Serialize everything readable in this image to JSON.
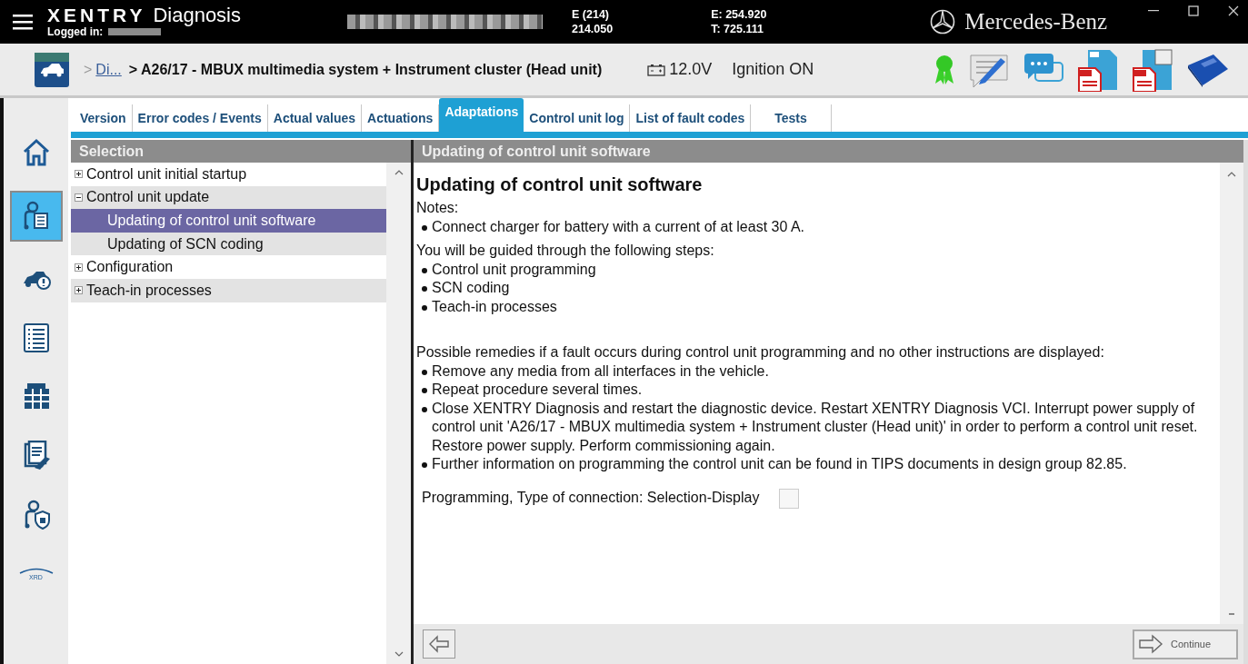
{
  "titlebar": {
    "brand": "XENTRY",
    "product": "Diagnosis",
    "logged_in_label": "Logged in:",
    "vehicle_model": "E (214)",
    "vehicle_code": "214.050",
    "engine": "E: 254.920",
    "transmission": "T: 725.111",
    "maker": "Mercedes-Benz"
  },
  "toolbar": {
    "breadcrumb_prefix": ">",
    "breadcrumb_link": "Di...",
    "breadcrumb_current": "> A26/17 - MBUX multimedia system + Instrument cluster (Head unit)",
    "voltage": "12.0V",
    "ignition": "Ignition ON"
  },
  "sidebar": {
    "items": [
      {
        "kind": "home",
        "selected": false
      },
      {
        "kind": "control-unit",
        "selected": true
      },
      {
        "kind": "car-alert",
        "selected": false
      },
      {
        "kind": "list",
        "selected": false
      },
      {
        "kind": "grid",
        "selected": false
      },
      {
        "kind": "document-wrench",
        "selected": false
      },
      {
        "kind": "lock-unit",
        "selected": false
      },
      {
        "kind": "xrd",
        "label": "XRD",
        "selected": false
      }
    ]
  },
  "tabs": [
    {
      "label": "Version",
      "selected": false
    },
    {
      "label": "Error codes / Events",
      "selected": false
    },
    {
      "label": "Actual values",
      "selected": false
    },
    {
      "label": "Actuations",
      "selected": false
    },
    {
      "label": "Adaptations",
      "selected": true
    },
    {
      "label": "Control unit log",
      "selected": false
    },
    {
      "label": "List of fault codes",
      "selected": false
    },
    {
      "label": "Tests",
      "selected": false
    }
  ],
  "tree": {
    "header": "Selection",
    "items": [
      {
        "label": "Control unit initial startup",
        "expanded": false,
        "selected": false
      },
      {
        "label": "Control unit update",
        "expanded": true,
        "selected": false,
        "children": [
          {
            "label": "Updating of control unit software",
            "selected": true
          },
          {
            "label": "Updating of SCN coding",
            "selected": false
          }
        ]
      },
      {
        "label": "Configuration",
        "expanded": false,
        "selected": false
      },
      {
        "label": "Teach-in processes",
        "expanded": false,
        "selected": false
      }
    ]
  },
  "content": {
    "header": "Updating of control unit software",
    "title": "Updating of control unit software",
    "notes_label": "Notes:",
    "notes": [
      "Connect charger for battery with a current of at least 30 A."
    ],
    "steps_intro": "You will be guided through the following steps:",
    "steps": [
      "Control unit programming",
      "SCN coding",
      "Teach-in processes"
    ],
    "remedies_intro": "Possible remedies if a fault occurs during control unit programming and no other instructions are displayed:",
    "remedies": [
      "Remove any media from all interfaces in the vehicle.",
      "Repeat procedure several times.",
      "Close XENTRY Diagnosis and restart the diagnostic device. Restart XENTRY Diagnosis VCI. Interrupt power supply of control unit 'A26/17 - MBUX multimedia system + Instrument cluster (Head unit)' in order to perform a control unit reset. Restore power supply. Perform commissioning again.",
      "Further information on programming the control unit can be found in TIPS documents in design group 82.85."
    ],
    "option": {
      "label": "Programming, Type of connection: Selection-Display",
      "checked": false
    },
    "continue_button": "Continue"
  }
}
